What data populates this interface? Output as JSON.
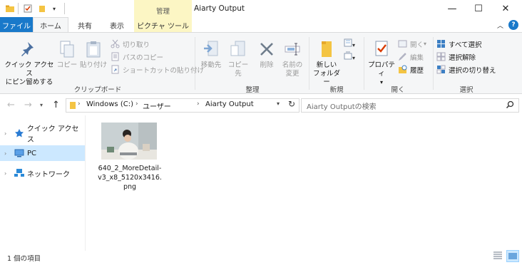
{
  "window": {
    "title": "Aiarty Output",
    "context_header": "管理",
    "controls": {
      "minimize": "—",
      "maximize": "☐",
      "close": "✕"
    }
  },
  "tabs": {
    "file": "ファイル",
    "home": "ホーム",
    "share": "共有",
    "view": "表示",
    "picture_tools": "ピクチャ ツール",
    "help": "?"
  },
  "ribbon": {
    "clipboard": {
      "group_label": "クリップボード",
      "pin_line1": "クイック アクセス",
      "pin_line2": "にピン留めする",
      "copy": "コピー",
      "paste": "貼り付け",
      "cut": "切り取り",
      "copy_path": "パスのコピー",
      "paste_shortcut": "ショートカットの貼り付け"
    },
    "organize": {
      "group_label": "整理",
      "move_to": "移動先",
      "copy_to": "コピー先",
      "delete": "削除",
      "rename_line1": "名前の",
      "rename_line2": "変更"
    },
    "new": {
      "group_label": "新規",
      "new_folder_line1": "新しい",
      "new_folder_line2": "フォルダー"
    },
    "open": {
      "group_label": "開く",
      "properties": "プロパティ",
      "open": "開く",
      "edit": "編集",
      "history": "履歴"
    },
    "select": {
      "group_label": "選択",
      "select_all": "すべて選択",
      "select_none": "選択解除",
      "invert": "選択の切り替え"
    }
  },
  "address": {
    "crumbs": [
      "Windows (C:)",
      "ユーザー",
      "Aiarty Output"
    ],
    "search_placeholder": "Aiarty Outputの検索"
  },
  "nav_pane": {
    "items": [
      {
        "label": "クイック アクセス"
      },
      {
        "label": "PC",
        "selected": true
      },
      {
        "label": "ネットワーク"
      }
    ]
  },
  "files": [
    {
      "name": "640_2_MoreDetail-v3_x8_5120x3416.png"
    }
  ],
  "status": {
    "item_count": "1 個の項目"
  },
  "colors": {
    "accent": "#1979ca",
    "context_tab": "#fcf6c4",
    "selection": "#cce8ff",
    "ribbon_bg": "#f5f6f7"
  }
}
